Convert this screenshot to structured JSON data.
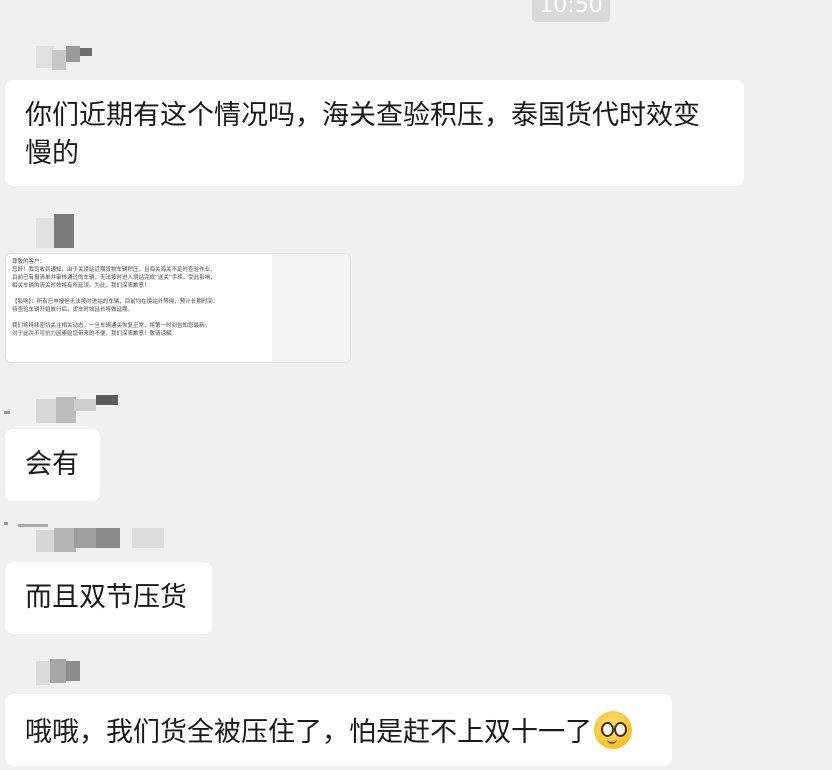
{
  "header": {
    "timestamp": "10:50"
  },
  "messages": [
    {
      "id": "m1",
      "type": "text",
      "text": "你们近期有这个情况吗，海关查验积压，泰国货代时效变慢的"
    },
    {
      "id": "m2",
      "type": "document-image",
      "lines": [
        "尊敬的客户：",
        "您好！我司收到通知，由于关境站近期货物车辆积压，且海关海关不定时查验作业，",
        "目前已有报清单并审核通过的车辆，无法按时进入境站完成“送关”手续。受此影响，",
        "相关车辆的清关时效将有所延误。为此，我们深表歉意！",
        "【影响】：所有已申报但无法按时进站的车辆，目前均在境站外等候，预计长期时间：",
        "待查验车辆开始放行后，货车时效延长将做延期。",
        "我们将持续密切关注相关动态，一旦车辆通关恢复正常，将第一时间告知您最新。",
        "对于此次不可抗力因素给您带来的不便，我们深表歉意！敬请谅解。"
      ]
    },
    {
      "id": "m3",
      "type": "text",
      "text": "会有"
    },
    {
      "id": "m4",
      "type": "text",
      "text": "而且双节压货"
    },
    {
      "id": "m5",
      "type": "text",
      "text": "哦哦，我们货全被压住了，怕是赶不上双十一了",
      "emoji": "grinning-face-emoji"
    }
  ],
  "colors": {
    "background": "#f0f0f0",
    "bubble": "#ffffff",
    "text": "#1a1a1a",
    "timestamp_bg": "#d9d9d9"
  }
}
